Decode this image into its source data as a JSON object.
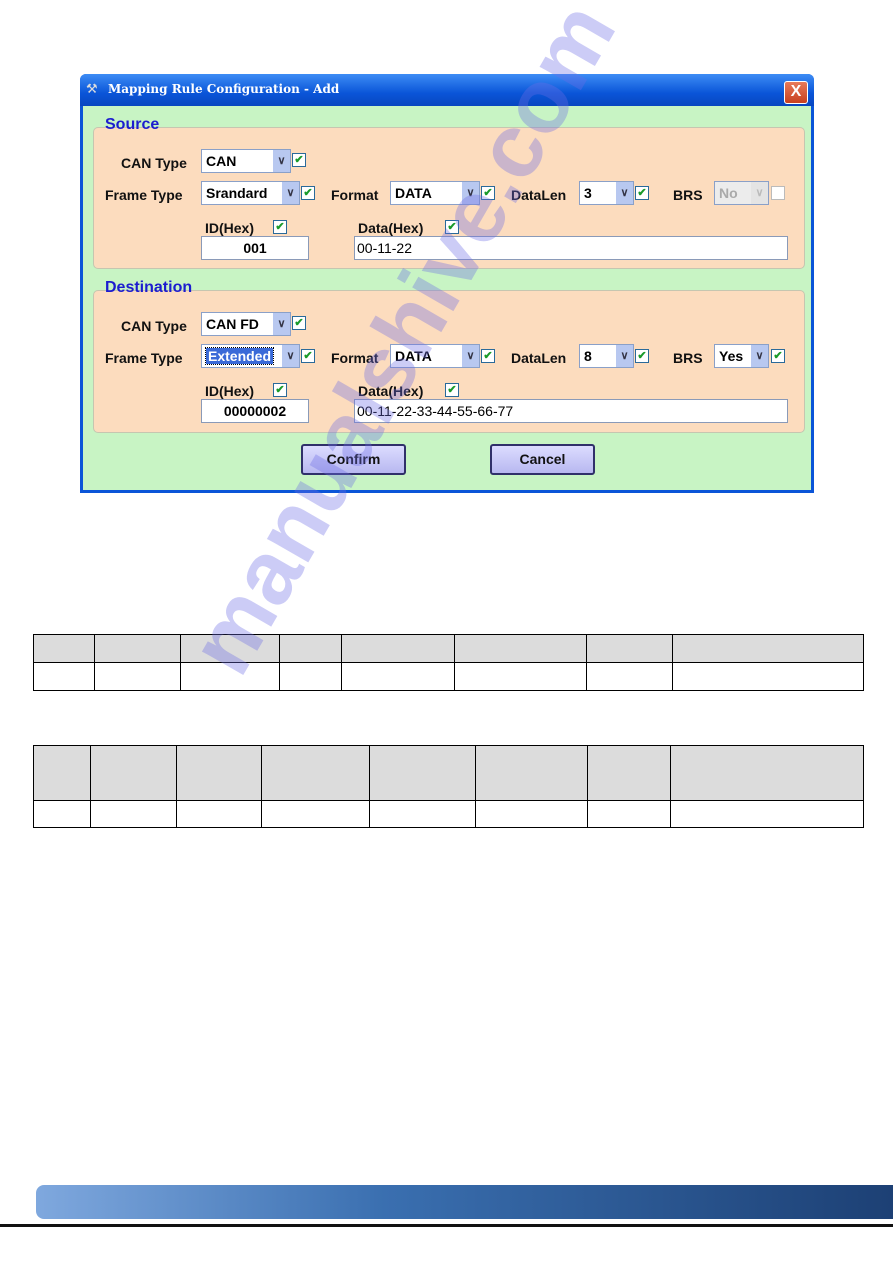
{
  "dialog": {
    "title": "Mapping Rule Configuration - Add",
    "close_symbol": "X",
    "source": {
      "title": "Source",
      "can_type_label": "CAN Type",
      "can_type": "CAN",
      "frame_type_label": "Frame Type",
      "frame_type": "Srandard",
      "format_label": "Format",
      "format": "DATA",
      "datalen_label": "DataLen",
      "datalen": "3",
      "brs_label": "BRS",
      "brs": "No",
      "id_label": "ID(Hex)",
      "id": "001",
      "data_label": "Data(Hex)",
      "data": "00-11-22",
      "brs_enabled": false,
      "brs_checked": false
    },
    "destination": {
      "title": "Destination",
      "can_type_label": "CAN Type",
      "can_type": "CAN FD",
      "frame_type_label": "Frame Type",
      "frame_type": "Extended",
      "format_label": "Format",
      "format": "DATA",
      "datalen_label": "DataLen",
      "datalen": "8",
      "brs_label": "BRS",
      "brs": "Yes",
      "id_label": "ID(Hex)",
      "id": "00000002",
      "data_label": "Data(Hex)",
      "data": "00-11-22-33-44-55-66-77",
      "brs_enabled": true,
      "brs_checked": true
    },
    "confirm_label": "Confirm",
    "cancel_label": "Cancel"
  },
  "watermark": "manualshive.com",
  "colors": {
    "title_bar": "#0a55d8",
    "body": "#c8f4c4",
    "group": "#fcdcbe",
    "group_title": "#1c1ccf"
  }
}
